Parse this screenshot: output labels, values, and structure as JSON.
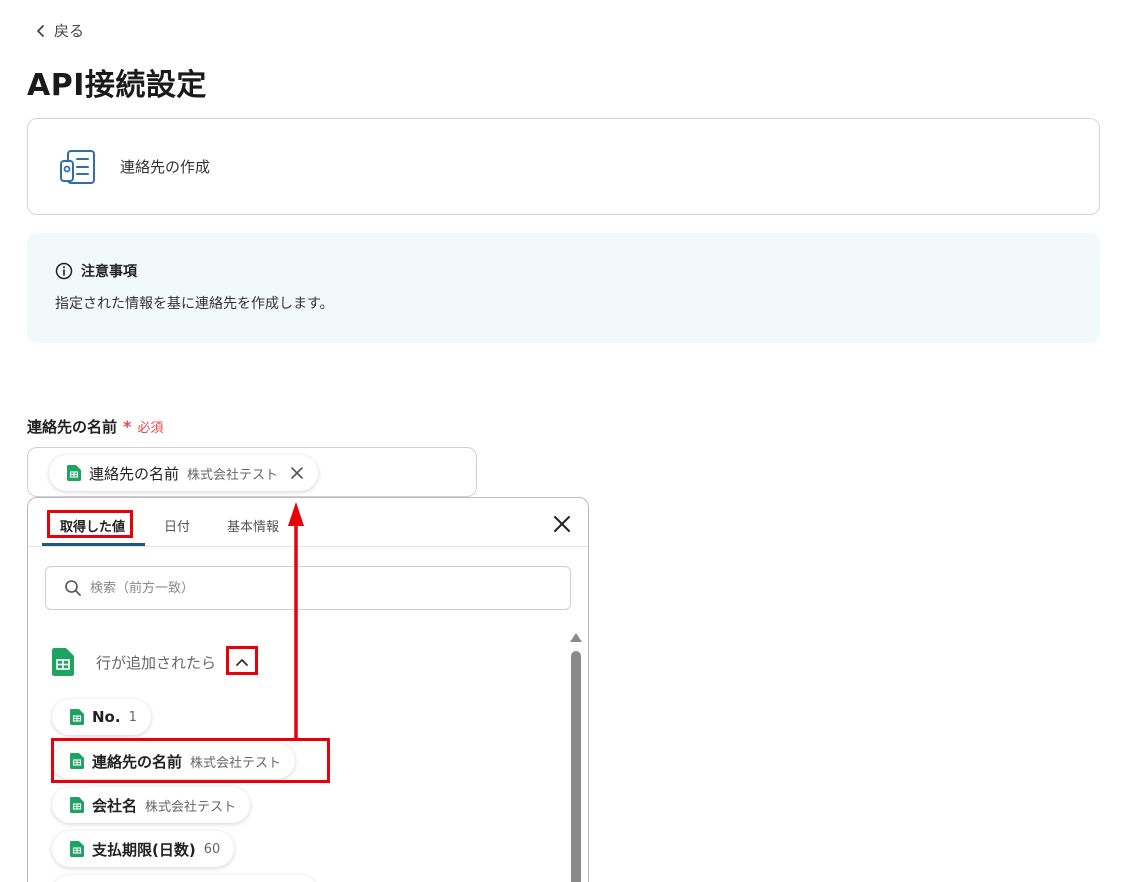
{
  "header": {
    "back_label": "戻る",
    "title": "API接続設定"
  },
  "action": {
    "label": "連絡先の作成",
    "icon": "contact-card-icon"
  },
  "notice": {
    "title": "注意事項",
    "body": "指定された情報を基に連絡先を作成します。"
  },
  "field": {
    "label": "連絡先の名前",
    "required_mark": "*",
    "required_label": "必須",
    "chip_name": "連絡先の名前",
    "chip_value": "株式会社テスト"
  },
  "dropdown": {
    "tabs": [
      "取得した値",
      "日付",
      "基本情報"
    ],
    "active_tab": "取得した値",
    "search_placeholder": "検索（前方一致）",
    "group_title": "行が追加されたら",
    "items": [
      {
        "name": "No.",
        "value": "1"
      },
      {
        "name": "連絡先の名前",
        "value": "株式会社テスト"
      },
      {
        "name": "会社名",
        "value": "株式会社テスト"
      },
      {
        "name": "支払期限(日数)",
        "value": "60"
      }
    ]
  },
  "colors": {
    "accent": "#1a5b79",
    "required": "#e5484d",
    "highlight": "#e8000b",
    "sheets_green": "#1ea362",
    "notice_bg": "#f2f9f9"
  }
}
